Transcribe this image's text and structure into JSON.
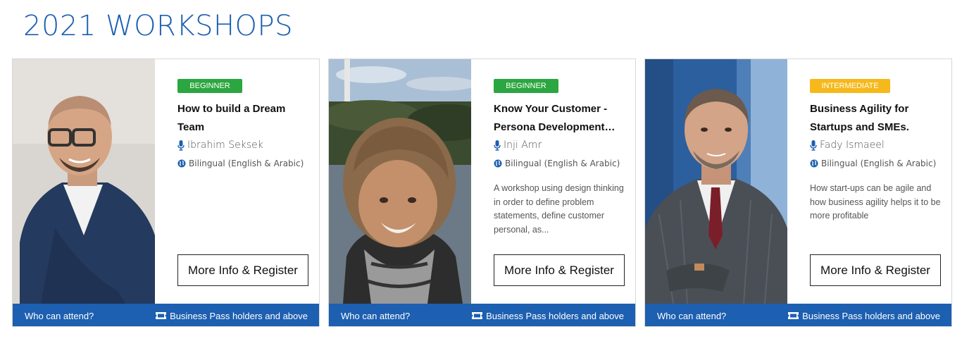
{
  "page": {
    "title": "2021 WORKSHOPS"
  },
  "colors": {
    "accent": "#1d5fb0",
    "beginner": "#2ca640",
    "intermediate": "#f6b91b"
  },
  "cards": [
    {
      "level": "BEGINNER",
      "title": "How to build a Dream Team",
      "speaker": "Ibrahim Seksek",
      "language": "Bilingual (English & Arabic)",
      "description": "",
      "button": "More Info & Register",
      "footer_left": "Who can attend?",
      "footer_right": "Business Pass holders and above"
    },
    {
      "level": "BEGINNER",
      "title": "Know Your Customer - Persona Development…",
      "speaker": "Inji Amr",
      "language": "Bilingual (English & Arabic)",
      "description": "A workshop using design thinking in order to define problem statements, define customer personal, as...",
      "button": "More Info & Register",
      "footer_left": "Who can attend?",
      "footer_right": "Business Pass holders and above"
    },
    {
      "level": "INTERMEDIATE",
      "title": "Business Agility for Startups and SMEs.",
      "speaker": "Fady Ismaeel",
      "language": "Bilingual (English & Arabic)",
      "description": "How start-ups can be agile and how business agility helps it to be more profitable",
      "button": "More Info & Register",
      "footer_left": "Who can attend?",
      "footer_right": "Business Pass holders and above"
    }
  ]
}
